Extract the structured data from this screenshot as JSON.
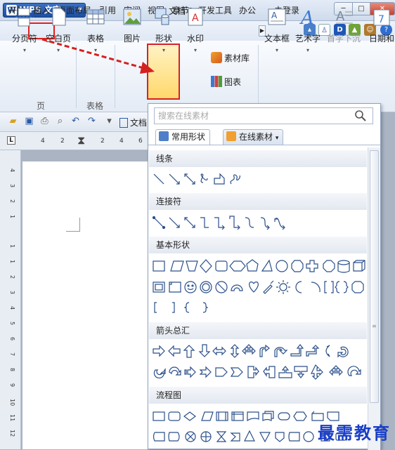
{
  "app": {
    "brand": "WPS 文字",
    "doc_title": "文档 1 *"
  },
  "window": {
    "min": "─",
    "max": "□",
    "close": "✕"
  },
  "menu": [
    "开始",
    "插入",
    "页面布局",
    "引用",
    "审阅",
    "视图",
    "章节",
    "开发工具",
    "办公"
  ],
  "menu_right": "未登录",
  "ribbon": {
    "page_break": "分页符",
    "blank_page": "空白页",
    "group_page": "页",
    "table": "表格",
    "group_table": "表格",
    "picture": "图片",
    "shape": "形状",
    "watermark": "水印",
    "material": "素材库",
    "chart": "图表",
    "textbox": "文本框",
    "wordart": "艺术字",
    "dropcap": "首字下沉",
    "date": "日期和"
  },
  "toolbar2": {
    "doc_tab": "文档"
  },
  "ruler_h": [
    "4",
    "2",
    "2",
    "4",
    "6"
  ],
  "ruler_v": [
    "4",
    "3",
    "2",
    "1",
    "1",
    "1",
    "2",
    "3",
    "4",
    "5",
    "6",
    "7",
    "8",
    "9",
    "10",
    "11",
    "12",
    "13",
    "14"
  ],
  "gallery": {
    "search_placeholder": "搜索在线素材",
    "tab_common": "常用形状",
    "tab_online": "在线素材",
    "cat_lines": "线条",
    "cat_connectors": "连接符",
    "cat_basic": "基本形状",
    "cat_arrows": "箭头总汇",
    "cat_flow": "流程图"
  },
  "watermark": "最需教育",
  "colors": {
    "highlight_red": "#e02020",
    "accent_blue": "#1d4f9f",
    "watermark_blue": "#1a3ec8"
  }
}
